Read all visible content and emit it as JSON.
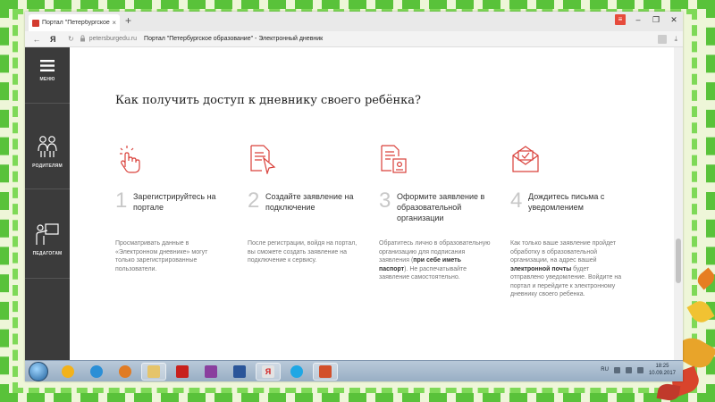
{
  "browser": {
    "tab_title": "Портал \"Петербургское",
    "tab_close": "×",
    "new_tab": "+",
    "window_controls": [
      "≡",
      "–",
      "❐",
      "✕"
    ],
    "back": "←",
    "yandex": "Я",
    "reload": "↻",
    "url": "petersburgedu.ru",
    "page_title": "Портал \"Петербургское образование\" - Электронный дневник",
    "download_icon": "⤓"
  },
  "sidebar": {
    "items": [
      {
        "label": "МЕНЮ",
        "icon": "hamburger-menu-icon"
      },
      {
        "label": "РОДИТЕЛЯМ",
        "icon": "parents-icon"
      },
      {
        "label": "ПЕДАГОГАМ",
        "icon": "teacher-icon"
      }
    ]
  },
  "main": {
    "heading": "Как получить доступ к дневнику своего ребёнка?",
    "steps": [
      {
        "num": "1",
        "title": "Зарегистрируйтесь на портале",
        "icon": "tap-hand-icon",
        "desc": "Просматривать данные в «Электронном дневнике» могут только зарегистрированные пользователи."
      },
      {
        "num": "2",
        "title": "Создайте заявление на подключение",
        "icon": "document-cursor-icon",
        "desc": "После регистрации, войдя на портал, вы сможете создать заявление на подключение к сервису."
      },
      {
        "num": "3",
        "title": "Оформите заявление в образовательной организации",
        "icon": "document-stamp-icon",
        "desc_before": "Обратитесь лично в образовательную организацию для подписания заявления (",
        "desc_bold": "при себе иметь паспорт",
        "desc_after": "). Не распечатывайте заявление самостоятельно."
      },
      {
        "num": "4",
        "title": "Дождитесь письма с уведомлением",
        "icon": "envelope-icon",
        "desc_before": "Как только ваше заявление пройдет обработку в образовательной организации, на адрес вашей ",
        "desc_bold": "электронной почты",
        "desc_after": " будет отправлено уведомление. Войдите на портал и перейдите к электронному дневнику своего ребенка."
      }
    ]
  },
  "taskbar": {
    "apps": [
      "windows-start",
      "yandex-browser",
      "ie",
      "media-player",
      "explorer",
      "acrobat",
      "winrar",
      "word",
      "yandex",
      "skype",
      "powerpoint"
    ],
    "lang": "RU",
    "time": "18:25",
    "date": "10.09.2017"
  },
  "colors": {
    "accent": "#d9403a",
    "sidebar_bg": "#3b3b3b",
    "frame_green": "#59c23a"
  }
}
